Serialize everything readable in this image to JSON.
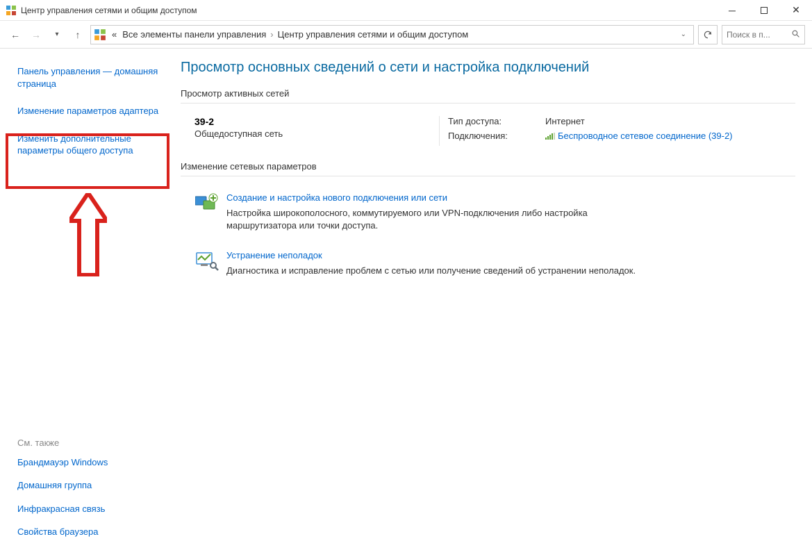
{
  "window": {
    "title": "Центр управления сетями и общим доступом"
  },
  "breadcrumb": {
    "prefix": "«",
    "item1": "Все элементы панели управления",
    "item2": "Центр управления сетями и общим доступом"
  },
  "search": {
    "placeholder": "Поиск в п..."
  },
  "sidebar": {
    "home": "Панель управления — домашняя страница",
    "adapter": "Изменение параметров адаптера",
    "advanced": "Изменить дополнительные параметры общего доступа",
    "seealso_label": "См. также",
    "seealso": {
      "firewall": "Брандмауэр Windows",
      "homegroup": "Домашняя группа",
      "infrared": "Инфракрасная связь",
      "browser": "Свойства браузера"
    }
  },
  "main": {
    "heading": "Просмотр основных сведений о сети и настройка подключений",
    "active_networks_label": "Просмотр активных сетей",
    "network": {
      "name": "39-2",
      "type": "Общедоступная сеть",
      "access_label": "Тип доступа:",
      "access_value": "Интернет",
      "conn_label": "Подключения:",
      "conn_link": "Беспроводное сетевое соединение (39-2)"
    },
    "change_settings_label": "Изменение сетевых параметров",
    "task1": {
      "title": "Создание и настройка нового подключения или сети",
      "desc": "Настройка широкополосного, коммутируемого или VPN-подключения либо настройка маршрутизатора или точки доступа."
    },
    "task2": {
      "title": "Устранение неполадок",
      "desc": "Диагностика и исправление проблем с сетью или получение сведений об устранении неполадок."
    }
  }
}
